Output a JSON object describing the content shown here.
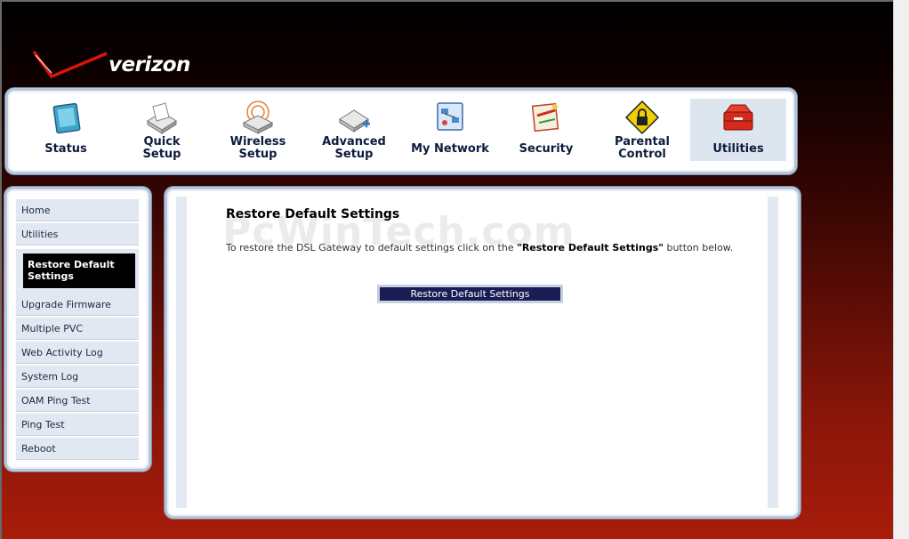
{
  "brand": {
    "logo_text": "verizon"
  },
  "nav": {
    "tabs": [
      {
        "label": "Status",
        "icon": "status-icon"
      },
      {
        "label": "Quick\nSetup",
        "icon": "quick-setup-icon"
      },
      {
        "label": "Wireless\nSetup",
        "icon": "wireless-setup-icon"
      },
      {
        "label": "Advanced\nSetup",
        "icon": "advanced-setup-icon"
      },
      {
        "label": "My Network",
        "icon": "my-network-icon"
      },
      {
        "label": "Security",
        "icon": "security-icon"
      },
      {
        "label": "Parental\nControl",
        "icon": "parental-control-icon"
      },
      {
        "label": "Utilities",
        "icon": "utilities-icon",
        "active": true
      }
    ]
  },
  "sidebar": {
    "items": [
      {
        "label": "Home"
      },
      {
        "label": "Utilities"
      },
      {
        "label": "Restore Default\nSettings",
        "active": true
      },
      {
        "label": "Upgrade Firmware"
      },
      {
        "label": "Multiple PVC"
      },
      {
        "label": "Web Activity Log"
      },
      {
        "label": "System Log"
      },
      {
        "label": "OAM Ping Test"
      },
      {
        "label": "Ping Test"
      },
      {
        "label": "Reboot"
      }
    ]
  },
  "main": {
    "watermark": "PcWinTech.com",
    "title": "Restore Default Settings",
    "text_before": "To restore the DSL Gateway to default settings click on the ",
    "text_bold": "\"Restore Default Settings\"",
    "text_after": " button below.",
    "button_label": "Restore Default Settings"
  },
  "colors": {
    "background_top": "#000000",
    "background_bottom": "#a81c0b",
    "frame_border": "#b8c6dc",
    "active_tab": "#dde5ef",
    "sidebar_item": "#e2e8f2",
    "sidebar_active": "#000000",
    "button_fill": "#1a1d55"
  }
}
